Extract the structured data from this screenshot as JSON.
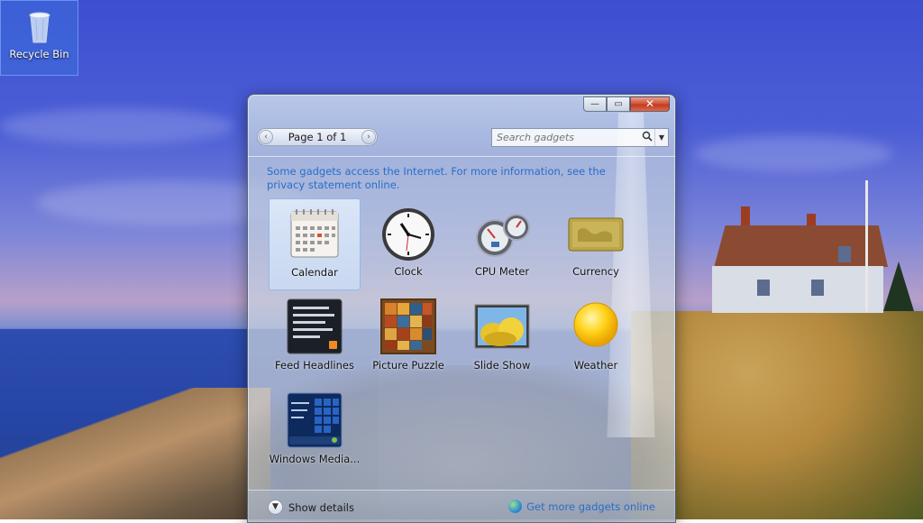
{
  "desktop": {
    "recycle_bin_label": "Recycle Bin"
  },
  "window": {
    "caption": {
      "minimize": "—",
      "maximize": "▭",
      "close": "✕"
    },
    "pager": {
      "text": "Page 1 of 1",
      "prev": "‹",
      "next": "›"
    },
    "search": {
      "placeholder": "Search gadgets",
      "icon": "search-icon",
      "dropdown": "▼"
    },
    "notice": "Some gadgets access the Internet.  For more information, see the privacy statement online.",
    "gadgets": [
      {
        "label": "Calendar",
        "icon": "calendar-icon",
        "selected": true
      },
      {
        "label": "Clock",
        "icon": "clock-icon",
        "selected": false
      },
      {
        "label": "CPU Meter",
        "icon": "cpu-meter-icon",
        "selected": false
      },
      {
        "label": "Currency",
        "icon": "currency-icon",
        "selected": false
      },
      {
        "label": "Feed Headlines",
        "icon": "feed-headlines-icon",
        "selected": false
      },
      {
        "label": "Picture Puzzle",
        "icon": "picture-puzzle-icon",
        "selected": false
      },
      {
        "label": "Slide Show",
        "icon": "slide-show-icon",
        "selected": false
      },
      {
        "label": "Weather",
        "icon": "weather-icon",
        "selected": false
      },
      {
        "label": "Windows Media...",
        "icon": "windows-media-icon",
        "selected": false
      }
    ],
    "footer": {
      "show_details": "Show details",
      "get_more": "Get more gadgets online"
    }
  },
  "colors": {
    "link": "#2a6ec6",
    "close_button": "#c43b20",
    "selection": "#cde1fa"
  }
}
